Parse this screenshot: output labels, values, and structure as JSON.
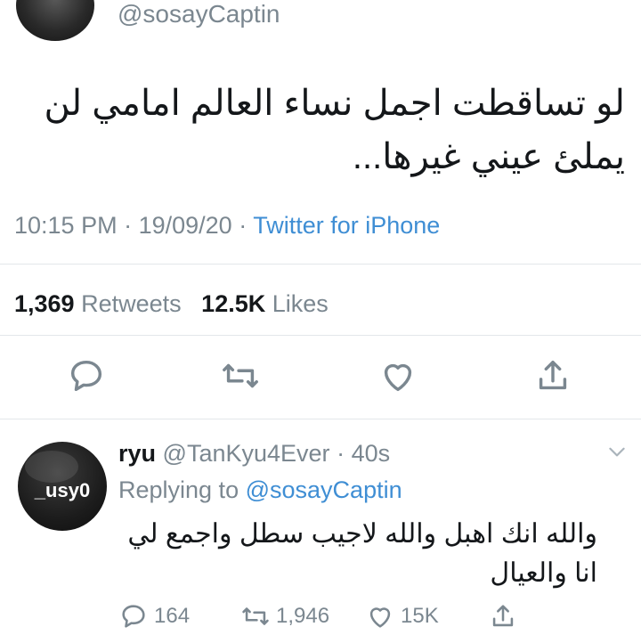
{
  "tweet": {
    "handle": "@sosayCaptin",
    "text": "لو تساقطت اجمل نساء العالم امامي لن يملئ عيني غيرها...",
    "time": "10:15 PM",
    "date": "19/09/20",
    "source": "Twitter for iPhone",
    "retweet_count": "1,369",
    "retweets_label": "Retweets",
    "like_count": "12.5K",
    "likes_label": "Likes"
  },
  "reply": {
    "avatar_text": "_usy0",
    "name": "ryu",
    "handle": "@TanKyu4Ever",
    "age": "40s",
    "replying_label": "Replying to",
    "replying_to": "@sosayCaptin",
    "text": "والله انك اهبل والله لاجيب سطل واجمع لي انا والعيال",
    "reply_count": "164",
    "retweet_count": "1,946",
    "like_count": "15K"
  },
  "icons": {
    "reply": "speech-bubble-icon",
    "retweet": "retweet-arrows-icon",
    "like": "heart-icon",
    "share": "share-arrow-icon",
    "more": "chevron-down-icon"
  },
  "colors": {
    "accent": "#3f8ed4",
    "secondary_text": "#7b8790"
  }
}
